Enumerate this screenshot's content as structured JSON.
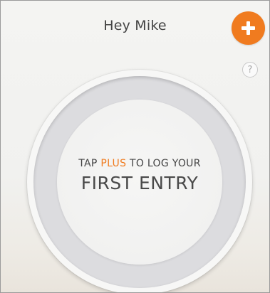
{
  "header": {
    "greeting": "Hey Mike"
  },
  "actions": {
    "add_label": "+",
    "help_label": "?"
  },
  "prompt": {
    "line1_before": "TAP ",
    "line1_accent": "PLUS",
    "line1_after": " TO LOG YOUR",
    "line2": "FIRST ENTRY"
  },
  "colors": {
    "accent": "#f07b1f",
    "text": "#444444",
    "ring": "#dcdcdf"
  },
  "icons": {
    "add": "plus-icon",
    "help": "question-mark-icon"
  }
}
